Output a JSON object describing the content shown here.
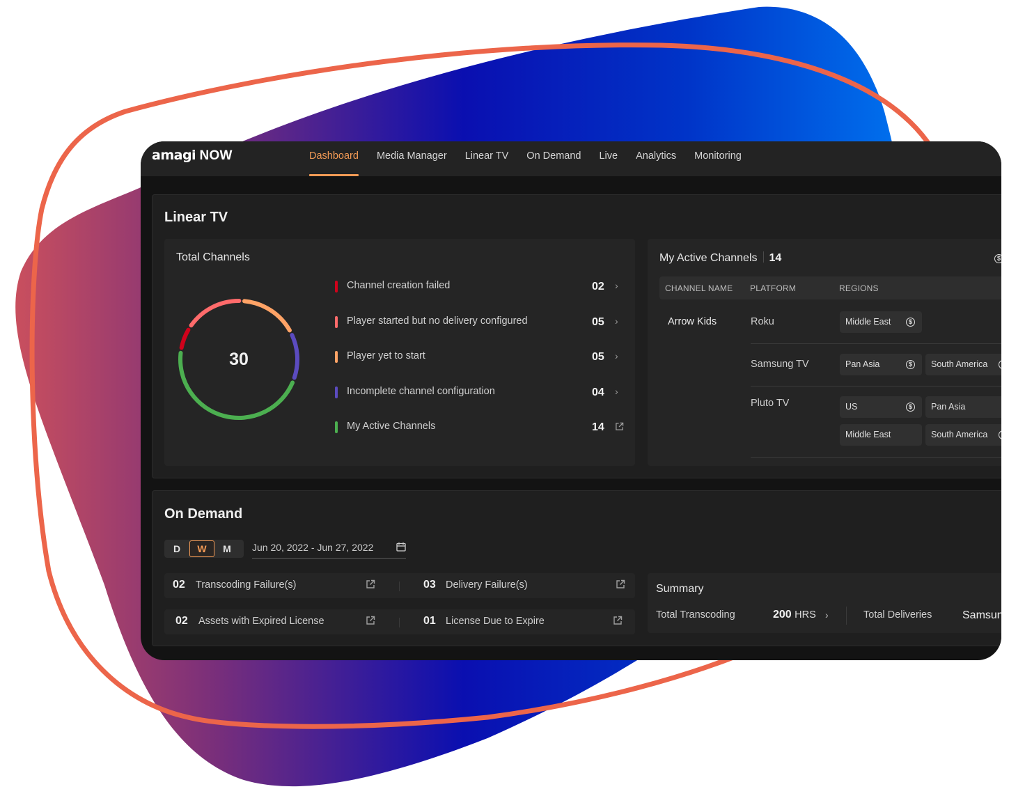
{
  "app": {
    "logo_prefix": "amagi",
    "logo_suffix": "NOW",
    "accent_color": "#f29a55"
  },
  "nav": {
    "items": [
      {
        "label": "Dashboard",
        "active": true
      },
      {
        "label": "Media Manager",
        "active": false
      },
      {
        "label": "Linear TV",
        "active": false
      },
      {
        "label": "On Demand",
        "active": false
      },
      {
        "label": "Live",
        "active": false
      },
      {
        "label": "Analytics",
        "active": false
      },
      {
        "label": "Monitoring",
        "active": false
      }
    ]
  },
  "linear_tv": {
    "title": "Linear TV",
    "total_channels": {
      "title": "Total Channels",
      "total": "30",
      "statuses": [
        {
          "label": "Channel creation failed",
          "count": "02",
          "color": "#d0021b",
          "action": "chevron-right"
        },
        {
          "label": "Player started but no delivery configured",
          "count": "05",
          "color": "#ff6b6b",
          "action": "chevron-right"
        },
        {
          "label": "Player yet to start",
          "count": "05",
          "color": "#ffa366",
          "action": "chevron-right"
        },
        {
          "label": "Incomplete channel configuration",
          "count": "04",
          "color": "#5b4bbf",
          "action": "chevron-right"
        },
        {
          "label": "My Active Channels",
          "count": "14",
          "color": "#4caf50",
          "action": "external-link"
        }
      ]
    },
    "active_channels": {
      "title": "My Active Channels",
      "count": "14",
      "columns": [
        "CHANNEL NAME",
        "PLATFORM",
        "REGIONS"
      ],
      "rows": [
        {
          "channel": "Arrow Kids",
          "platforms": [
            {
              "name": "Roku",
              "regions": [
                {
                  "name": "Middle East",
                  "monetized": true
                }
              ]
            },
            {
              "name": "Samsung TV",
              "regions": [
                {
                  "name": "Pan Asia",
                  "monetized": true
                },
                {
                  "name": "South America",
                  "monetized": true
                }
              ]
            },
            {
              "name": "Pluto TV",
              "regions": [
                {
                  "name": "US",
                  "monetized": true
                },
                {
                  "name": "Pan Asia",
                  "monetized": false
                },
                {
                  "name": "Middle East",
                  "monetized": false
                },
                {
                  "name": "South America",
                  "monetized": true
                }
              ]
            }
          ]
        }
      ]
    }
  },
  "on_demand": {
    "title": "On Demand",
    "periods": [
      {
        "label": "D",
        "active": false
      },
      {
        "label": "W",
        "active": true
      },
      {
        "label": "M",
        "active": false
      }
    ],
    "date_range": "Jun 20, 2022 - Jun 27, 2022",
    "issues": [
      {
        "count": "02",
        "label": "Transcoding Failure(s)"
      },
      {
        "count": "03",
        "label": "Delivery Failure(s)"
      },
      {
        "count": "02",
        "label": "Assets with Expired License"
      },
      {
        "count": "01",
        "label": "License Due to Expire"
      }
    ],
    "summary": {
      "title": "Summary",
      "total_transcoding_label": "Total Transcoding",
      "total_transcoding_value": "200",
      "total_transcoding_unit": "HRS",
      "total_deliveries_label": "Total Deliveries",
      "total_deliveries_platform": "Samsung"
    }
  }
}
